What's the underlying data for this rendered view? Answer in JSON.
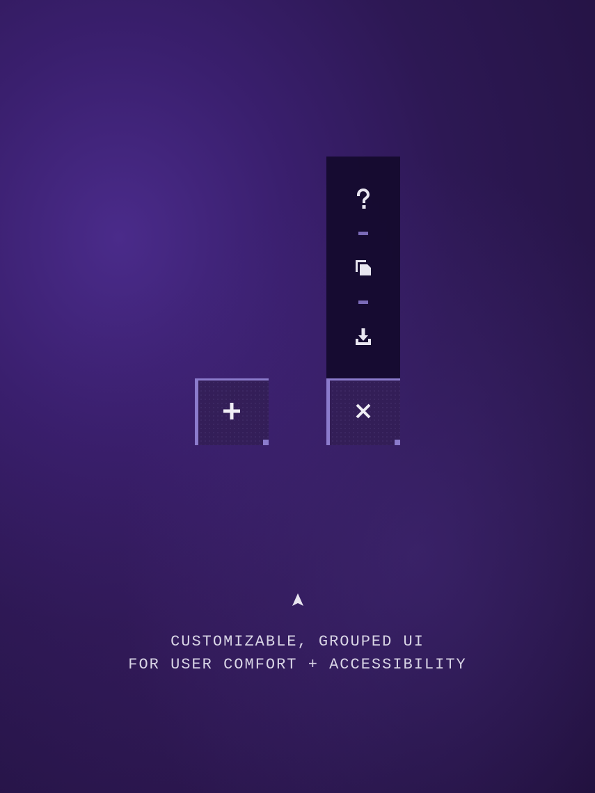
{
  "toolbar": {
    "help_label": "help",
    "copy_label": "copy",
    "download_label": "download"
  },
  "buttons": {
    "add_label": "add",
    "close_label": "close"
  },
  "footer": {
    "pointer_label": "pointer",
    "line1": "CUSTOMIZABLE, GROUPED UI",
    "line2": "FOR USER COMFORT + ACCESSIBILITY"
  }
}
